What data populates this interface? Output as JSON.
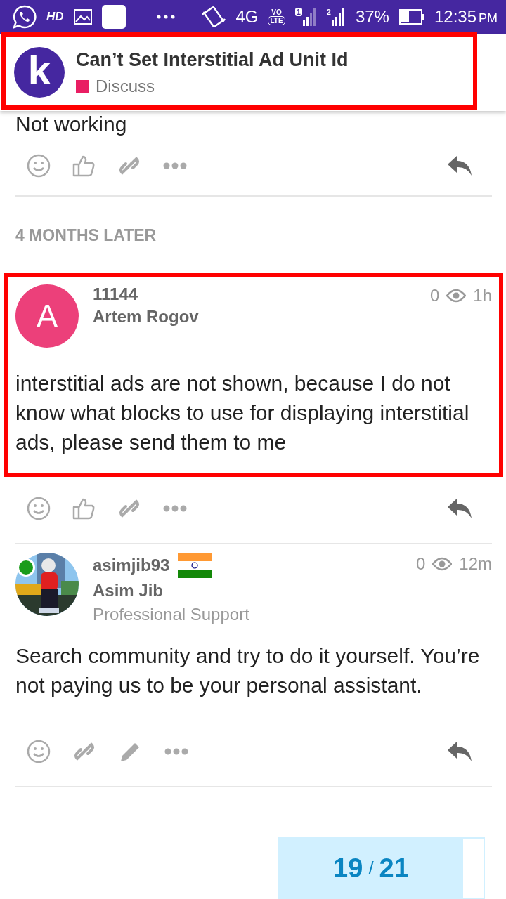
{
  "status_bar": {
    "hd": "HD",
    "network": "4G",
    "volte": [
      "VO",
      "LTE"
    ],
    "sim1": "1",
    "sim2": "2",
    "battery_percent": "37%",
    "time": "12:35",
    "ampm": "PM"
  },
  "header": {
    "logo_letter": "k",
    "title": "Can’t Set Interstitial Ad Unit Id",
    "category": {
      "name": "Discuss",
      "color": "#e91e63"
    },
    "highlighted": true
  },
  "posts": [
    {
      "kind": "partial",
      "text": "Not working",
      "highlighted": false,
      "actions": [
        {
          "kind": "smile"
        },
        {
          "kind": "like"
        },
        {
          "kind": "link"
        },
        {
          "kind": "more"
        }
      ]
    },
    {
      "kind": "gap",
      "label": "4 MONTHS LATER"
    },
    {
      "kind": "post",
      "avatar": {
        "kind": "letter",
        "letter": "A",
        "color": "#ec407a"
      },
      "online": false,
      "username": "11144",
      "name": "Artem Rogov",
      "likes": "0",
      "time": "1h",
      "text": "interstitial ads are not shown, because I do not know what blocks to use for displaying interstitial ads, please send them to me",
      "highlighted": true,
      "actions": [
        {
          "kind": "smile"
        },
        {
          "kind": "like"
        },
        {
          "kind": "link"
        },
        {
          "kind": "more"
        }
      ]
    },
    {
      "kind": "post",
      "online": true,
      "username": "asimjib93",
      "flag": true,
      "name": "Asim Jib",
      "user_title": "Professional Support",
      "likes": "0",
      "time": "12m",
      "text": "Search community and try to do it yourself. You’re not paying us to be your personal assistant.",
      "highlighted": false,
      "actions": [
        {
          "kind": "smile"
        },
        {
          "kind": "link"
        },
        {
          "kind": "edit"
        },
        {
          "kind": "more"
        }
      ]
    }
  ],
  "progress": {
    "current": "19",
    "separator": "/",
    "total": "21",
    "level": 0.9
  }
}
